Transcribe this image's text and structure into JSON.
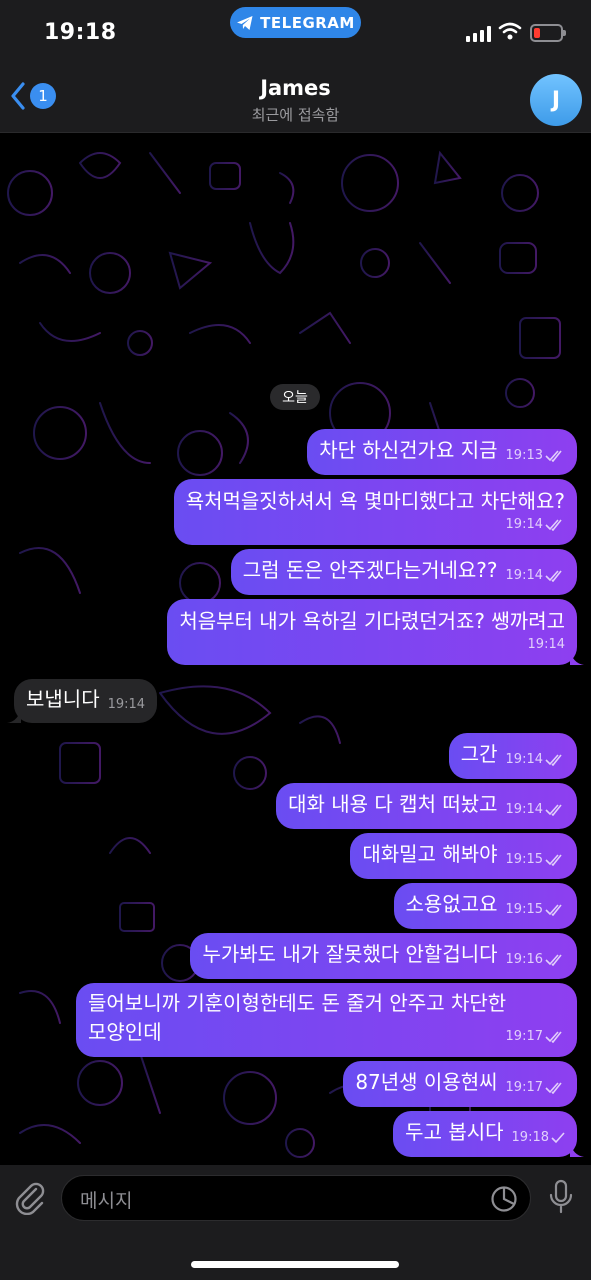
{
  "status": {
    "time": "19:18",
    "app_pill": "TELEGRAM"
  },
  "header": {
    "back_badge": "1",
    "title": "James",
    "subtitle": "최근에 접속함",
    "avatar_letter": "J"
  },
  "chat": {
    "date": "오늘",
    "messages": [
      {
        "dir": "out",
        "text": "차단 하신건가요 지금",
        "time": "19:13"
      },
      {
        "dir": "out",
        "text": "욕처먹을짓하셔서 욕 몇마디했다고 차단해요?",
        "time": "19:14"
      },
      {
        "dir": "out",
        "text": "그럼 돈은 안주겠다는거네요??",
        "time": "19:14"
      },
      {
        "dir": "out",
        "text": "처음부터 내가 욕하길 기다렸던거죠? 쌩까려고",
        "time": "19:14"
      },
      {
        "dir": "in",
        "text": "보냅니다",
        "time": "19:14"
      },
      {
        "dir": "out",
        "text": "그간",
        "time": "19:14"
      },
      {
        "dir": "out",
        "text": "대화 내용 다 캡처 떠놨고",
        "time": "19:14"
      },
      {
        "dir": "out",
        "text": "대화밀고 해봐야",
        "time": "19:15"
      },
      {
        "dir": "out",
        "text": "소용없고요",
        "time": "19:15"
      },
      {
        "dir": "out",
        "text": "누가봐도 내가 잘못했다 안할겁니다",
        "time": "19:16"
      },
      {
        "dir": "out",
        "text": "들어보니까 기훈이형한테도 돈 줄거 안주고 차단한",
        "text2": "모양인데",
        "time": "19:17"
      },
      {
        "dir": "out",
        "text": "87년생 이용현씨",
        "time": "19:17"
      },
      {
        "dir": "out",
        "text": "두고 봅시다",
        "time": "19:18"
      }
    ]
  },
  "input": {
    "placeholder": "메시지"
  },
  "colors": {
    "accent": "#3a8ef0",
    "bubble_out_start": "#6a4df2",
    "bubble_out_end": "#8e3ff0",
    "bubble_in": "#262628"
  },
  "icons": [
    "telegram-plane-icon",
    "chevron-left-icon",
    "attach-icon",
    "sticker-icon",
    "mic-icon",
    "double-check-icon",
    "single-check-icon"
  ]
}
